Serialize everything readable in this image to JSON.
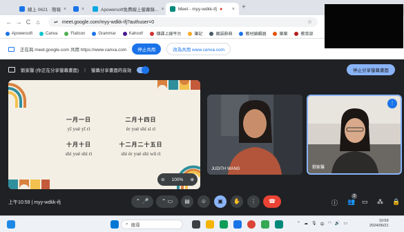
{
  "browser": {
    "tabs": [
      {
        "label": "線上 0621 · 簡報",
        "color": "#1a73e8"
      },
      {
        "label": "",
        "color": "#1a73e8"
      },
      {
        "label": "Apowersoft免費線上螢幕錄...",
        "color": "#0aa7e0"
      },
      {
        "label": "Meet - myy-wdkk-ifj",
        "color": "#00897b"
      }
    ],
    "new_tab": "+",
    "url": "meet.google.com/myy-wdkk-ifj?authuser=0",
    "nav": {
      "back": "←",
      "forward": "→",
      "reload": "C",
      "home": "⌂"
    },
    "star": "☆"
  },
  "bookmarks": [
    {
      "label": "Apowersoft",
      "color": "#1a73e8"
    },
    {
      "label": "Canva",
      "color": "#00c4cc"
    },
    {
      "label": "Flaticon",
      "color": "#4caf50"
    },
    {
      "label": "Grammar",
      "color": "#1a73e8"
    },
    {
      "label": "Kahoot!",
      "color": "#46178f"
    },
    {
      "label": "傳課上線平台",
      "color": "#d32f2f"
    },
    {
      "label": "筆記",
      "color": "#f9a825"
    },
    {
      "label": "國語辭典",
      "color": "#455a64"
    },
    {
      "label": "教材編輯器",
      "color": "#1a73e8"
    },
    {
      "label": "樂樂",
      "color": "#e65100"
    },
    {
      "label": "教育部",
      "color": "#b71c1c"
    }
  ],
  "share_bar": {
    "message": "正在與 meet.google.com 共用 https://www.canva.com",
    "stop_label": "停止共用",
    "switch_label": "改為共用 www.canva.com"
  },
  "present_bar": {
    "label": "劉家馨 (你正在分享螢幕畫面)",
    "audio_label": "螢幕分享畫面的音效",
    "stop_label": "停止分享螢幕畫面"
  },
  "slide": {
    "dates": [
      {
        "hanzi": "一月一日",
        "pinyin": "yī yuè yī rì"
      },
      {
        "hanzi": "二月十四日",
        "pinyin": "èr yuè shí sì rì"
      },
      {
        "hanzi": "十月十日",
        "pinyin": "shí yuè shí rì"
      },
      {
        "hanzi": "十二月二十五日",
        "pinyin": "shí èr yuè shí wǔ rì"
      }
    ],
    "zoom": "100%"
  },
  "participants": [
    {
      "name": "JUDITH WANG"
    },
    {
      "name": "劉家馨"
    }
  ],
  "controls": {
    "time": "上午10:59",
    "separator": "|",
    "meeting_code": "myy-wdkk-ifj",
    "people_count": "3"
  },
  "taskbar": {
    "search_placeholder": "搜尋",
    "tray_text": "中",
    "clock_time": "10:59",
    "clock_date": "2024/06/21"
  }
}
